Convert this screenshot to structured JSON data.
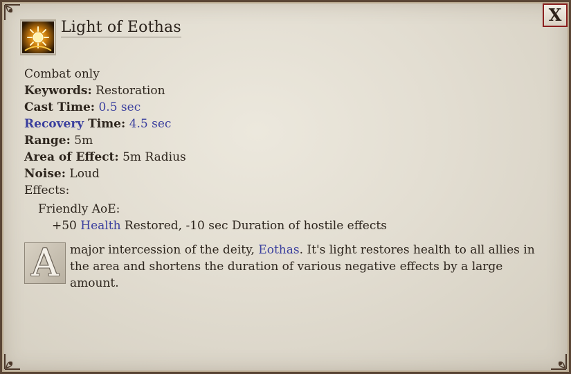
{
  "dialog": {
    "title": "Light of Eothas",
    "close_label": "X",
    "icon": "sun-burst-icon"
  },
  "stats": {
    "combat_only": "Combat only",
    "keywords_label": "Keywords:",
    "keywords_value": "Restoration",
    "cast_time_label": "Cast Time:",
    "cast_time_value": "0.5 sec",
    "recovery_link": "Recovery",
    "recovery_time_label": " Time:",
    "recovery_time_value": "4.5 sec",
    "range_label": "Range:",
    "range_value": "5m",
    "aoe_label": "Area of Effect:",
    "aoe_value": "5m Radius",
    "noise_label": "Noise:",
    "noise_value": "Loud",
    "effects_label": "Effects:",
    "friendly_aoe": "Friendly AoE:",
    "effect_prefix": "+50 ",
    "effect_health_link": "Health",
    "effect_suffix": " Restored, -10 sec Duration of hostile effects"
  },
  "description": {
    "drop_cap": "A",
    "part1": " major intercession of the deity, ",
    "deity_link": "Eothas",
    "part2": ". It's light restores health to all allies in the area and shortens the duration of various negative effects by a large amount."
  },
  "colors": {
    "link": "#3a3f9e",
    "close_border": "#8a1f1f",
    "text": "#2d251d"
  }
}
